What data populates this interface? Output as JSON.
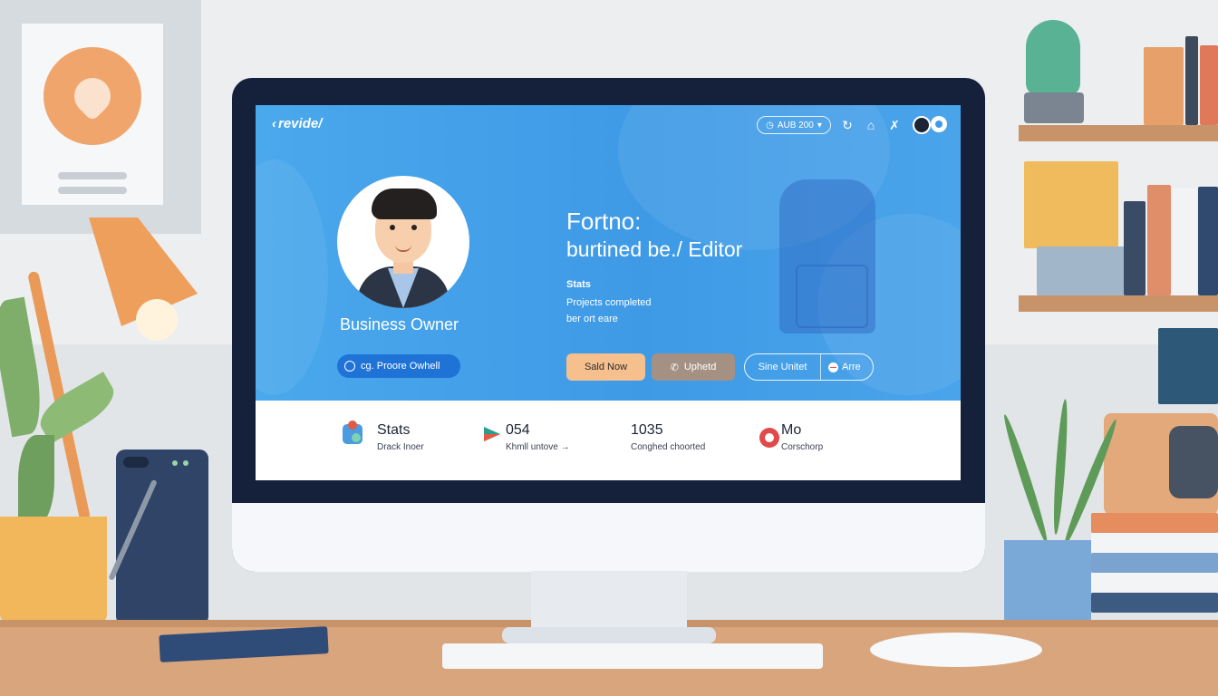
{
  "app": {
    "brand": "revide/",
    "brand_arrow": "‹"
  },
  "nav": {
    "language_pill": "AUB 200",
    "language_icon": "globe-icon",
    "language_chevron": "▾",
    "icons": [
      "refresh-icon",
      "home-icon",
      "tools-icon",
      "avatar",
      "app-logo-icon"
    ]
  },
  "profile": {
    "role": "Business Owner",
    "pill_label": "cg. Proore Owhell"
  },
  "hero": {
    "headline": "Fortno:",
    "subhead": "burtined be./ Editor",
    "stats_title": "Stats",
    "stats_lines": [
      "Projects completed",
      "ber ort eare"
    ]
  },
  "actions": {
    "send": "Sald Now",
    "upload": "Uphetd",
    "upload_icon": "phone-icon",
    "split_left": "Sine Unitet",
    "split_right": "Arre"
  },
  "stats": [
    {
      "icon": "people-icon",
      "value": "Stats",
      "label": "Drack Inoer",
      "accent": "#e05a44"
    },
    {
      "icon": "play-icon",
      "value": "054",
      "label": "Khmll untove →",
      "accent": "#2a9d8f"
    },
    {
      "icon": "",
      "value": "1035",
      "label": "Conghed choorted",
      "accent": ""
    },
    {
      "icon": "record-icon",
      "value": "Mo",
      "label": "Corschorp",
      "accent": "#e04a4a"
    }
  ],
  "colors": {
    "hero_blue": "#3f9ae6",
    "pill_blue": "#1f73d6",
    "send_button": "#f5c08e",
    "upload_button": "#a49184",
    "monitor_bezel": "#15203b"
  }
}
